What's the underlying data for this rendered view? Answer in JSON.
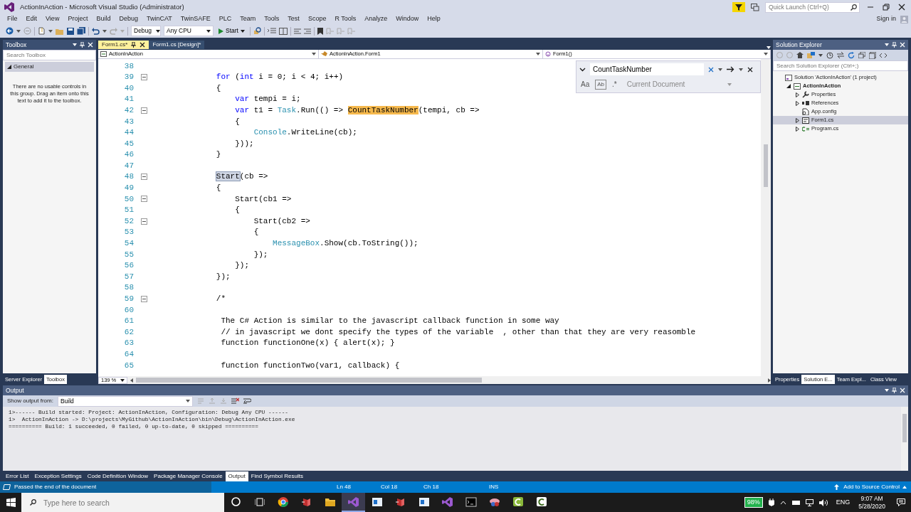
{
  "window": {
    "title": "ActionInAction - Microsoft Visual Studio  (Administrator)"
  },
  "quick_launch": {
    "placeholder": "Quick Launch (Ctrl+Q)"
  },
  "menu": [
    "File",
    "Edit",
    "View",
    "Project",
    "Build",
    "Debug",
    "TwinCAT",
    "TwinSAFE",
    "PLC",
    "Team",
    "Tools",
    "Test",
    "Scope",
    "R Tools",
    "Analyze",
    "Window",
    "Help"
  ],
  "account": {
    "label": "Sign in"
  },
  "toolbar": {
    "configuration": "Debug",
    "platform": "Any CPU",
    "start": "Start"
  },
  "toolbox": {
    "title": "Toolbox",
    "search_placeholder": "Search Toolbox",
    "group": {
      "label": "General",
      "expanded": true
    },
    "empty_message": "There are no usable controls in this group. Drag an item onto this text to add it to the toolbox."
  },
  "left_tabs": [
    {
      "label": "Server Explorer",
      "selected": false
    },
    {
      "label": "Toolbox",
      "selected": true
    }
  ],
  "editor": {
    "tabs": [
      {
        "label": "Form1.cs*",
        "selected": true
      },
      {
        "label": "Form1.cs [Design]*",
        "selected": false
      }
    ],
    "nav": [
      {
        "label": "ActionInAction",
        "kind": "project"
      },
      {
        "label": "ActionInAction.Form1",
        "kind": "class"
      },
      {
        "label": "Form1()",
        "kind": "method"
      }
    ],
    "find": {
      "value": "CountTaskNumber",
      "options": [
        "Aa",
        "Ab",
        ".*"
      ],
      "scope": "Current Document"
    },
    "zoom": "139 %",
    "lines": [
      {
        "number": "38"
      },
      {
        "number": "39",
        "fold": true,
        "segments": [
          {
            "text": "        for",
            "kind": "keyword"
          },
          {
            "text": " (",
            "kind": "plain"
          },
          {
            "text": "int",
            "kind": "keyword"
          },
          {
            "text": " i = 0; i < 4; i++)",
            "kind": "plain"
          }
        ]
      },
      {
        "number": "40",
        "segments": [
          {
            "text": "        {",
            "kind": "plain"
          }
        ]
      },
      {
        "number": "41",
        "segments": [
          {
            "text": "            var",
            "kind": "keyword"
          },
          {
            "text": " tempi = i;",
            "kind": "plain"
          }
        ]
      },
      {
        "number": "42",
        "fold": true,
        "segments": [
          {
            "text": "            var",
            "kind": "keyword"
          },
          {
            "text": " t1 = ",
            "kind": "plain"
          },
          {
            "text": "Task",
            "kind": "type"
          },
          {
            "text": ".Run(() => ",
            "kind": "plain"
          },
          {
            "text": "CountTaskNumber",
            "kind": "match"
          },
          {
            "text": "(tempi, cb =>",
            "kind": "plain"
          }
        ]
      },
      {
        "number": "43",
        "segments": [
          {
            "text": "            {",
            "kind": "plain"
          }
        ]
      },
      {
        "number": "44",
        "segments": [
          {
            "text": "                Console",
            "kind": "type"
          },
          {
            "text": ".WriteLine(cb);",
            "kind": "plain"
          }
        ]
      },
      {
        "number": "45",
        "segments": [
          {
            "text": "            }));",
            "kind": "plain"
          }
        ]
      },
      {
        "number": "46",
        "segments": [
          {
            "text": "        }",
            "kind": "plain"
          }
        ]
      },
      {
        "number": "47"
      },
      {
        "number": "48",
        "fold": true,
        "segments": [
          {
            "text": "        Start",
            "kind": "selection"
          },
          {
            "text": "(cb =>",
            "kind": "plain"
          }
        ]
      },
      {
        "number": "49",
        "segments": [
          {
            "text": "        {",
            "kind": "plain"
          }
        ]
      },
      {
        "number": "50",
        "fold": true,
        "segments": [
          {
            "text": "            Start(cb1 =>",
            "kind": "plain"
          }
        ]
      },
      {
        "number": "51",
        "segments": [
          {
            "text": "            {",
            "kind": "plain"
          }
        ]
      },
      {
        "number": "52",
        "fold": true,
        "segments": [
          {
            "text": "                Start(cb2 =>",
            "kind": "plain"
          }
        ]
      },
      {
        "number": "53",
        "segments": [
          {
            "text": "                {",
            "kind": "plain"
          }
        ]
      },
      {
        "number": "54",
        "segments": [
          {
            "text": "                    MessageBox",
            "kind": "type"
          },
          {
            "text": ".Show(cb.ToString());",
            "kind": "plain"
          }
        ]
      },
      {
        "number": "55",
        "segments": [
          {
            "text": "                });",
            "kind": "plain"
          }
        ]
      },
      {
        "number": "56",
        "segments": [
          {
            "text": "            });",
            "kind": "plain"
          }
        ]
      },
      {
        "number": "57",
        "segments": [
          {
            "text": "        });",
            "kind": "plain"
          }
        ]
      },
      {
        "number": "58"
      },
      {
        "number": "59",
        "fold": true,
        "segments": [
          {
            "text": "        /*",
            "kind": "plain"
          }
        ]
      },
      {
        "number": "60"
      },
      {
        "number": "61",
        "segments": [
          {
            "text": "         The C# Action is similar to the javascript callback function in some way",
            "kind": "plain"
          }
        ]
      },
      {
        "number": "62",
        "segments": [
          {
            "text": "         // in javascript we dont specify the types of the variable  , other than that they are very reasomble",
            "kind": "plain"
          }
        ]
      },
      {
        "number": "63",
        "segments": [
          {
            "text": "         function functionOne(x) { alert(x); }",
            "kind": "plain"
          }
        ]
      },
      {
        "number": "64"
      },
      {
        "number": "65",
        "segments": [
          {
            "text": "         function functionTwo(var1, callback) {",
            "kind": "plain"
          }
        ]
      }
    ]
  },
  "solution_explorer": {
    "title": "Solution Explorer",
    "search_placeholder": "Search Solution Explorer (Ctrl+;)",
    "tree": [
      {
        "label": "Solution 'ActionInAction' (1 project)",
        "kind": "solution",
        "selected": false,
        "children": [
          {
            "label": "ActionInAction",
            "kind": "project",
            "expanded": true,
            "selected": false,
            "children": [
              {
                "label": "Properties",
                "kind": "properties",
                "expanded": false,
                "selected": false
              },
              {
                "label": "References",
                "kind": "references",
                "expanded": false,
                "selected": false
              },
              {
                "label": "App.config",
                "kind": "config",
                "selected": false
              },
              {
                "label": "Form1.cs",
                "kind": "form",
                "expanded": false,
                "selected": true
              },
              {
                "label": "Program.cs",
                "kind": "csharp",
                "expanded": false,
                "selected": false
              }
            ]
          }
        ]
      }
    ]
  },
  "right_tabs": [
    {
      "label": "Properties",
      "selected": false
    },
    {
      "label": "Solution E...",
      "selected": true
    },
    {
      "label": "Team Expl...",
      "selected": false
    },
    {
      "label": "Class View",
      "selected": false
    }
  ],
  "output": {
    "title": "Output",
    "source_label": "Show output from:",
    "source": "Build",
    "lines": [
      "1>------ Build started: Project: ActionInAction, Configuration: Debug Any CPU ------",
      "1>  ActionInAction -> D:\\projects\\MyGithub\\ActionInAction\\bin\\Debug\\ActionInAction.exe",
      "========== Build: 1 succeeded, 0 failed, 0 up-to-date, 0 skipped =========="
    ]
  },
  "bottom_tabs": [
    {
      "label": "Error List",
      "selected": false
    },
    {
      "label": "Exception Settings",
      "selected": false
    },
    {
      "label": "Code Definition Window",
      "selected": false
    },
    {
      "label": "Package Manager Console",
      "selected": false
    },
    {
      "label": "Output",
      "selected": true
    },
    {
      "label": "Find Symbol Results",
      "selected": false
    }
  ],
  "status_bar": {
    "message": "Passed the end of the document",
    "line": "Ln 48",
    "col": "Col 18",
    "ch": "Ch 18",
    "mode": "INS",
    "source_control": "Add to Source Control"
  },
  "taskbar": {
    "search_placeholder": "Type here to search",
    "apps": [
      {
        "kind": "browser",
        "active": false
      },
      {
        "kind": "red-tool",
        "active": false
      },
      {
        "kind": "folder",
        "active": false
      },
      {
        "kind": "vs",
        "active": true
      },
      {
        "kind": "window",
        "active": false
      },
      {
        "kind": "red-tool",
        "active": false
      },
      {
        "kind": "window",
        "active": false
      },
      {
        "kind": "vs",
        "active": false
      },
      {
        "kind": "terminal",
        "active": false
      },
      {
        "kind": "pink-tool",
        "active": false
      },
      {
        "kind": "green-c",
        "active": false
      },
      {
        "kind": "white-c",
        "active": false
      }
    ],
    "battery": "98%",
    "language": "ENG",
    "time": "9:07 AM",
    "date": "5/28/2020"
  }
}
